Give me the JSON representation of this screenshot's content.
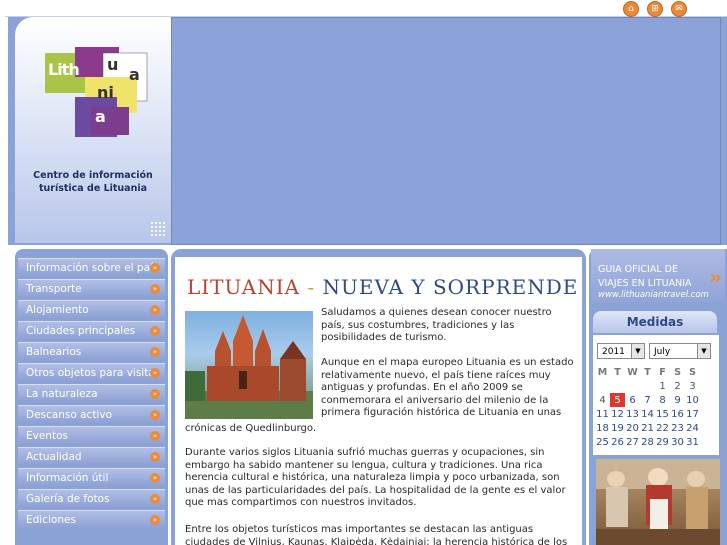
{
  "header": {
    "brand_text": "Centro de información turística de Lituania",
    "logo": {
      "line1": "Lith",
      "line2": "u",
      "line3": "a",
      "line4": "ni",
      "line5": "a"
    }
  },
  "top_icons": [
    "home-icon",
    "sitemap-icon",
    "mail-icon"
  ],
  "sidebar": {
    "items": [
      {
        "label": "Información sobre el país"
      },
      {
        "label": "Transporte"
      },
      {
        "label": "Alojamiento"
      },
      {
        "label": "Ciudades principales"
      },
      {
        "label": "Balnearios"
      },
      {
        "label": "Otros objetos para visitar"
      },
      {
        "label": "La naturaleza"
      },
      {
        "label": "Descanso activo"
      },
      {
        "label": "Eventos"
      },
      {
        "label": "Actualidad"
      },
      {
        "label": "Información útil"
      },
      {
        "label": "Galería de fotos"
      },
      {
        "label": "Ediciones"
      }
    ]
  },
  "main": {
    "title_part1": "LITUANIA",
    "title_dash": "-",
    "title_part2": "NUEVA Y SORPRENDE",
    "para1": "Saludamos a quienes desean conocer nuestro país, sus costumbres, tradiciones y las posibilidades de turismo.",
    "para2": "Aunque en el mapa europeo Lituania es un estado relativamente nuevo, el país tiene raíces muy antiguas y profundas. En el año 2009 se conmemorara el aniversario del milenio de la primera figuración histórica  de Lituania en unas crónicas de Quedlinburgo.",
    "para3": "Durante varios siglos Lituania sufrió muchas guerras y ocupaciones, sin embargo ha sabido mantener su  lengua, cultura y tradiciones. Una rica herencia cultural e histórica, una naturaleza limpia y poco urbanizada, son unas de las particularidades del país. La hospitalidad de la gente es el valor que mas compartimos con nuestros invitados.",
    "para4": "Entre los objetos turísticos mas importantes se destacan las antiguas ciudades de Vilnius, Kaunas, Klaipėda, Kėdainiai; la herencia histórica de los antiguos"
  },
  "right": {
    "guide_line1": "GUIA OFICIAL DE",
    "guide_line2": "VIAJES EN LITUANIA",
    "guide_url": "www.lithuaniantravel.com",
    "measures_title": "Medidas",
    "calendar": {
      "year": "2011",
      "month": "July",
      "weekdays": [
        "M",
        "T",
        "W",
        "T",
        "F",
        "S",
        "S"
      ],
      "weeks": [
        [
          "",
          "",
          "",
          "",
          "1",
          "2",
          "3"
        ],
        [
          "4",
          "5",
          "6",
          "7",
          "8",
          "9",
          "10"
        ],
        [
          "11",
          "12",
          "13",
          "14",
          "15",
          "16",
          "17"
        ],
        [
          "18",
          "19",
          "20",
          "21",
          "22",
          "23",
          "24"
        ],
        [
          "25",
          "26",
          "27",
          "28",
          "29",
          "30",
          "31"
        ]
      ],
      "today": "5"
    }
  },
  "colors": {
    "accent": "#e98b3d",
    "panel": "#8aa2d5",
    "title": "#b8432c",
    "navy": "#2e4a86"
  }
}
